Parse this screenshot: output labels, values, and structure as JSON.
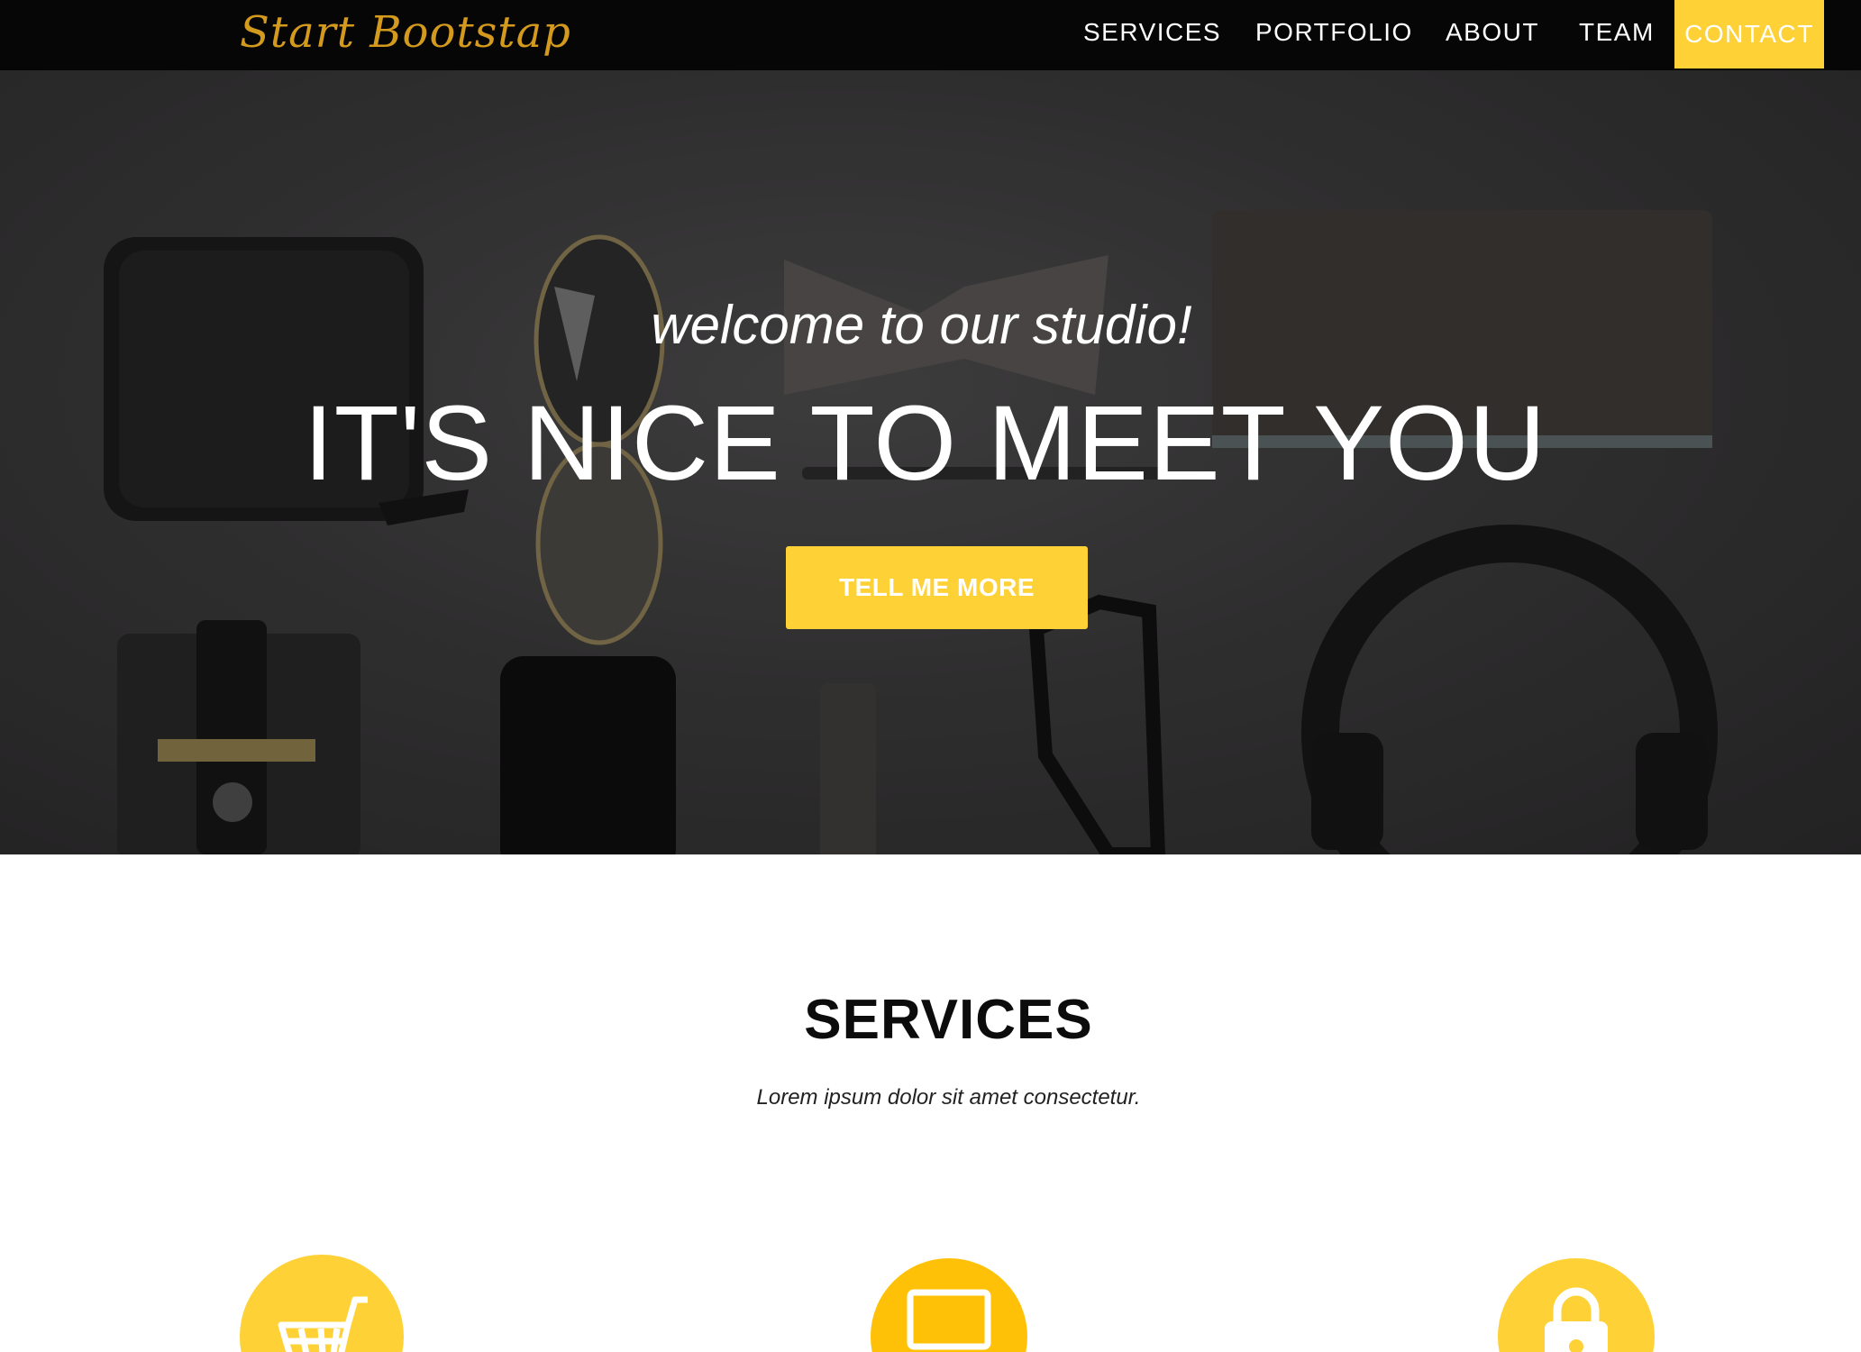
{
  "navbar": {
    "brand": "Start Bootstap",
    "items": [
      {
        "label": "SERVICES"
      },
      {
        "label": "PORTFOLIO"
      },
      {
        "label": "ABOUT"
      },
      {
        "label": "TEAM"
      },
      {
        "label": "CONTACT"
      }
    ]
  },
  "hero": {
    "subheading": "welcome to our studio!",
    "heading": "IT'S NICE TO MEET YOU",
    "button_label": "TELL ME MORE"
  },
  "services": {
    "title": "SERVICES",
    "subtitle": "Lorem ipsum dolor sit amet consectetur.",
    "items": [
      {
        "icon": "shopping-cart-icon"
      },
      {
        "icon": "laptop-icon"
      },
      {
        "icon": "lock-icon"
      }
    ]
  },
  "colors": {
    "accent": "#fed136",
    "navbar_bg": "#060606",
    "brand_text": "#d49a1e"
  }
}
